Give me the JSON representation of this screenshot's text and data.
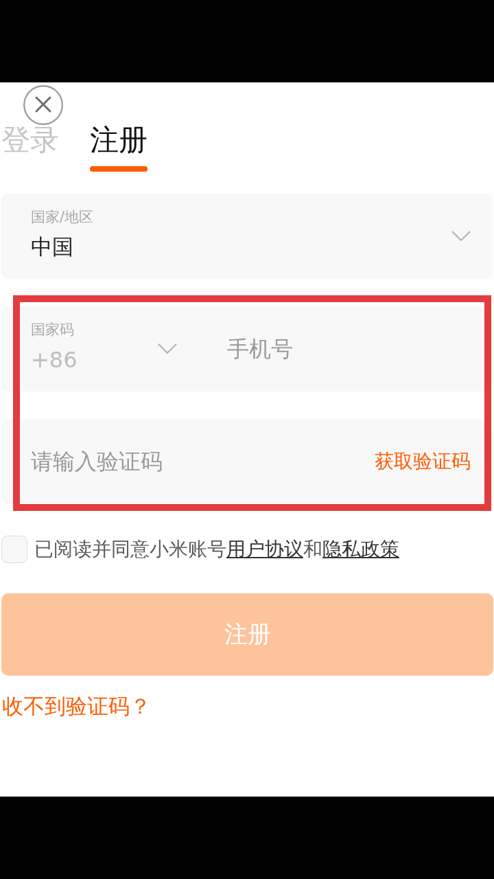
{
  "tabs": [
    {
      "label": "登录",
      "selected": false
    },
    {
      "label": "注册",
      "selected": true
    }
  ],
  "region_field": {
    "label": "国家/地区",
    "value": "中国"
  },
  "phone_field": {
    "code_label": "国家码",
    "code_value": "+86",
    "placeholder": "手机号"
  },
  "code_field": {
    "placeholder": "请输入验证码",
    "action": "获取验证码"
  },
  "agreement": {
    "checked": false,
    "parts": [
      {
        "kind": "text",
        "text": "已阅读并同意小米账号"
      },
      {
        "kind": "link",
        "text": "用户协议"
      },
      {
        "kind": "text",
        "text": "和"
      },
      {
        "kind": "link",
        "text": "隐私政策"
      }
    ]
  },
  "submit_button": {
    "label": "注册",
    "disabled": true
  },
  "help_link": "收不到验证码？"
}
